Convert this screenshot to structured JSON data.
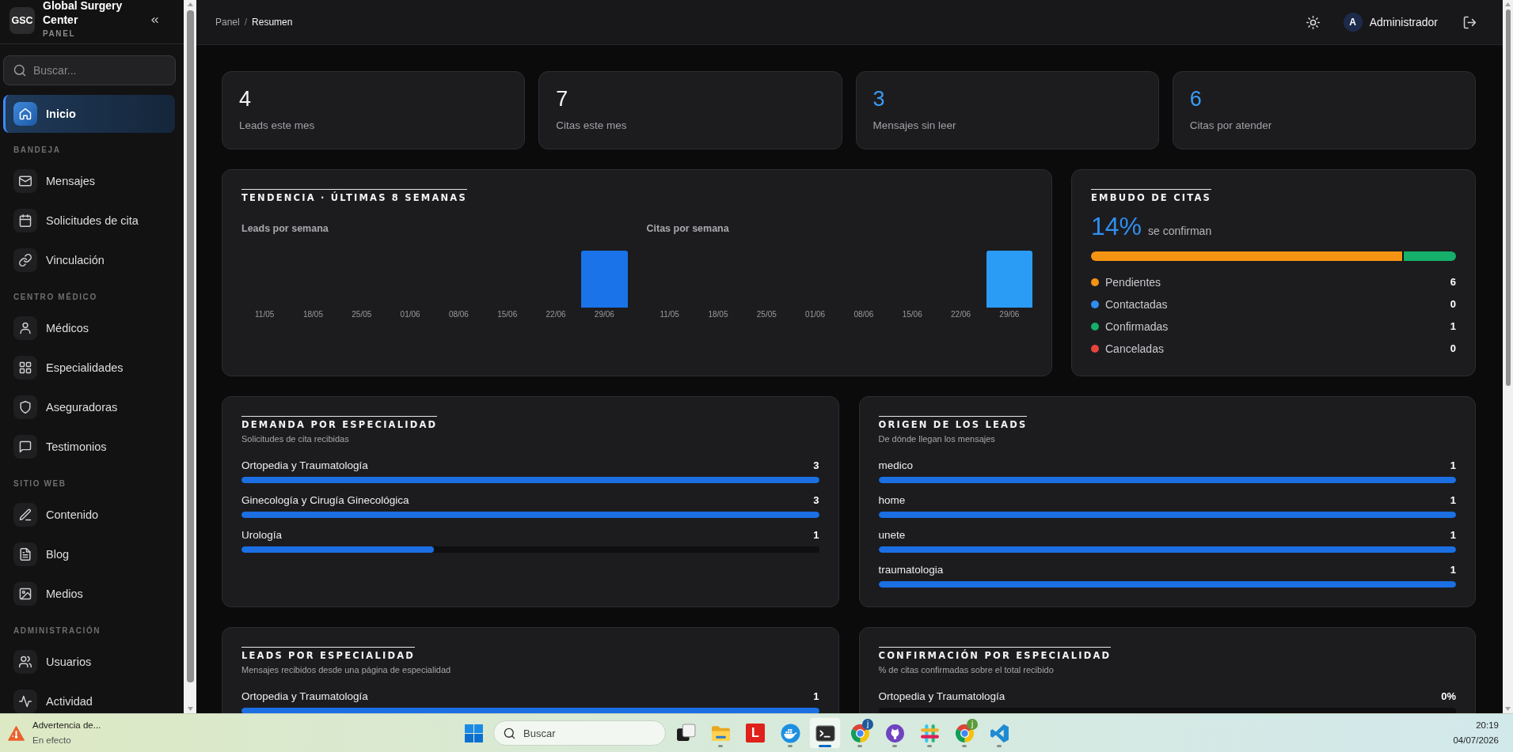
{
  "sidebar": {
    "logo": "GSC",
    "brand": "Global Surgery Center",
    "subtitle": "PANEL",
    "search": {
      "placeholder": "Buscar..."
    },
    "items": [
      {
        "label": "Inicio",
        "selected": true
      }
    ],
    "sections": [
      {
        "title": "BANDEJA",
        "items": [
          {
            "label": "Mensajes",
            "selected": false
          },
          {
            "label": "Solicitudes de cita",
            "selected": false
          },
          {
            "label": "Vinculación",
            "selected": false
          }
        ]
      },
      {
        "title": "CENTRO MÉDICO",
        "items": [
          {
            "label": "Médicos",
            "selected": false
          },
          {
            "label": "Especialidades",
            "selected": false
          },
          {
            "label": "Aseguradoras",
            "selected": false
          },
          {
            "label": "Testimonios",
            "selected": false
          }
        ]
      },
      {
        "title": "SITIO WEB",
        "items": [
          {
            "label": "Contenido",
            "selected": false
          },
          {
            "label": "Blog",
            "selected": false
          },
          {
            "label": "Medios",
            "selected": false
          }
        ]
      },
      {
        "title": "ADMINISTRACIÓN",
        "items": [
          {
            "label": "Usuarios",
            "selected": false
          },
          {
            "label": "Actividad",
            "selected": false
          }
        ]
      }
    ]
  },
  "header": {
    "breadcrumb": {
      "separator": "/",
      "items": [
        {
          "label": "Panel",
          "current": false
        },
        {
          "label": "Resumen",
          "current": true
        }
      ]
    },
    "user": {
      "initial": "A",
      "name": "Administrador"
    }
  },
  "stats": [
    {
      "value": "4",
      "label": "Leads este mes",
      "color": "#f4f4f5"
    },
    {
      "value": "7",
      "label": "Citas este mes",
      "color": "#f4f4f5"
    },
    {
      "value": "3",
      "label": "Mensajes sin leer",
      "color": "#3a9bf4"
    },
    {
      "value": "6",
      "label": "Citas por atender",
      "color": "#3a9bf4"
    }
  ],
  "trend": {
    "title": "TENDENCIA · ÚLTIMAS 8 SEMANAS",
    "charts": [
      {
        "title": "Leads por semana",
        "color": "#1a73e8",
        "weeks": [
          "11/05",
          "18/05",
          "25/05",
          "01/06",
          "08/06",
          "15/06",
          "22/06",
          "29/06"
        ]
      },
      {
        "title": "Citas por semana",
        "color": "#2b9cf5",
        "weeks": [
          "11/05",
          "18/05",
          "25/05",
          "01/06",
          "08/06",
          "15/06",
          "22/06",
          "29/06"
        ]
      }
    ]
  },
  "funnel": {
    "title": "EMBUDO DE CITAS",
    "rate": "14%",
    "caption": "se confirman",
    "stages": [
      {
        "label": "Pendientes",
        "count": "6",
        "color": "#f59313",
        "level": 0.857
      },
      {
        "label": "Contactadas",
        "count": "0",
        "color": "#2f8df0"
      },
      {
        "label": "Confirmadas",
        "count": "1",
        "color": "#15b06a",
        "level": 0.143
      },
      {
        "label": "Canceladas",
        "count": "0",
        "color": "#e5453c"
      }
    ]
  },
  "panels": [
    {
      "title": "DEMANDA POR ESPECIALIDAD",
      "subtitle": "Solicitudes de cita recibidas",
      "rows": [
        {
          "label": "Ortopedia y Traumatología",
          "value": "3",
          "level": 1
        },
        {
          "label": "Ginecología y Cirugía Ginecológica",
          "value": "3",
          "level": 1
        },
        {
          "label": "Urología",
          "value": "1",
          "level": 0.333
        }
      ]
    },
    {
      "title": "ORIGEN DE LOS LEADS",
      "subtitle": "De dónde llegan los mensajes",
      "rows": [
        {
          "label": "medico",
          "value": "1",
          "level": 1
        },
        {
          "label": "home",
          "value": "1",
          "level": 1
        },
        {
          "label": "unete",
          "value": "1",
          "level": 1
        },
        {
          "label": "traumatologia",
          "value": "1",
          "level": 1
        }
      ]
    },
    {
      "title": "LEADS POR ESPECIALIDAD",
      "subtitle": "Mensajes recibidos desde una página de especialidad",
      "rows": [
        {
          "label": "Ortopedia y Traumatología",
          "value": "1",
          "level": 1
        }
      ]
    },
    {
      "title": "CONFIRMACIÓN POR ESPECIALIDAD",
      "subtitle": "% de citas confirmadas sobre el total recibido",
      "rows": [
        {
          "label": "Ortopedia y Traumatología",
          "value": "0%"
        }
      ]
    }
  ],
  "taskbar": {
    "weather": {
      "title": "Advertencia de...",
      "status": "En efecto"
    },
    "search": {
      "placeholder": "Buscar"
    },
    "apps": [
      {
        "running": false,
        "active": false
      },
      {
        "running": true,
        "active": false
      },
      {
        "glyph": "L",
        "running": false,
        "active": false
      },
      {
        "running": true,
        "active": false
      },
      {
        "running": true,
        "active": true
      },
      {
        "running": true,
        "active": false,
        "badge": {
          "letter": "j",
          "color": "#1d5a9c"
        }
      },
      {
        "running": true,
        "active": false
      },
      {
        "running": true,
        "active": false
      },
      {
        "running": true,
        "active": false,
        "badge": {
          "letter": "j",
          "color": "#5b9b3a"
        }
      },
      {
        "running": true,
        "active": false
      }
    ],
    "clock": {
      "time": "20:19",
      "date": "04/07/2026"
    }
  }
}
